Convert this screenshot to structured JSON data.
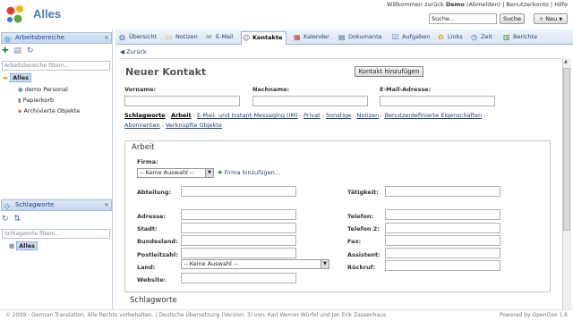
{
  "app": {
    "title": "Alles",
    "welcome_prefix": "Willkommen zurück",
    "user": "Demo",
    "logout": "(Abmelden)",
    "separator": "|",
    "account": "Benutzerkonto",
    "help": "Hilfe",
    "search_value": "Suche...",
    "search_button": "Suche",
    "new_button": "Neu"
  },
  "sidebar": {
    "workspaces_title": "Arbeitsbereiche",
    "workspaces_filter_placeholder": "Arbeitsbereiche filtern...",
    "tree": [
      {
        "label": "Alles",
        "selected": true
      },
      {
        "label": "demo Personal"
      },
      {
        "label": "Papierkorb"
      },
      {
        "label": "Archivierte Objekte"
      }
    ],
    "tags_title": "Schlagworte",
    "tags_filter_placeholder": "Schlagworte filtern...",
    "tags_tree": [
      {
        "label": "Alles",
        "selected": true
      }
    ]
  },
  "tabs": [
    {
      "label": "Übersicht",
      "icon": "globe-icon"
    },
    {
      "label": "Notizen",
      "icon": "note-icon"
    },
    {
      "label": "E-Mail",
      "icon": "mail-icon"
    },
    {
      "label": "Kontakte",
      "icon": "contact-icon",
      "active": true
    },
    {
      "label": "Kalender",
      "icon": "calendar-icon"
    },
    {
      "label": "Dokumente",
      "icon": "document-icon"
    },
    {
      "label": "Aufgaben",
      "icon": "tasks-icon"
    },
    {
      "label": "Links",
      "icon": "links-icon"
    },
    {
      "label": "Zeit",
      "icon": "clock-icon"
    },
    {
      "label": "Berichte",
      "icon": "chart-icon"
    }
  ],
  "main": {
    "back": "Zurück",
    "title": "Neuer Kontakt",
    "add_contact": "Kontakt hinzufügen",
    "firstname_label": "Vorname:",
    "lastname_label": "Nachname:",
    "email_label": "E-Mail-Adresse:",
    "section_links": {
      "current": "Schlagworte",
      "items": [
        "Arbeit",
        "E-Mail- und Instant-Messaging (IM)",
        "Privat",
        "Sonstige",
        "Notizen",
        "Benutzerdefinierte Eigenschaften",
        "Abonnenten",
        "Verknüpfte Objekte"
      ]
    },
    "work": {
      "legend": "Arbeit",
      "company_label": "Firma:",
      "company_select": "-- Keine Auswahl --",
      "add_company": "Firma hinzufügen...",
      "department_label": "Abteilung:",
      "job_label": "Tätigkeit:",
      "address_label": "Adresse:",
      "city_label": "Stadt:",
      "state_label": "Bundesland:",
      "zip_label": "Postleitzahl:",
      "country_label": "Land:",
      "country_select": "-- Keine Auswahl --",
      "website_label": "Website:",
      "phone_label": "Telefon:",
      "phone2_label": "Telefon 2:",
      "fax_label": "Fax:",
      "assistant_label": "Assistent:",
      "callback_label": "Rückruf:"
    },
    "tags_legend": "Schlagworte"
  },
  "footer": {
    "left": "© 2009 - German Translation. Alle Rechte vorbehalten. | Deutsche Übersetzung (Version: 3) von: Karl Werner Würfel und Jan Erik Zassenhaus",
    "right": "Powered by OpenGoo 1.6"
  }
}
